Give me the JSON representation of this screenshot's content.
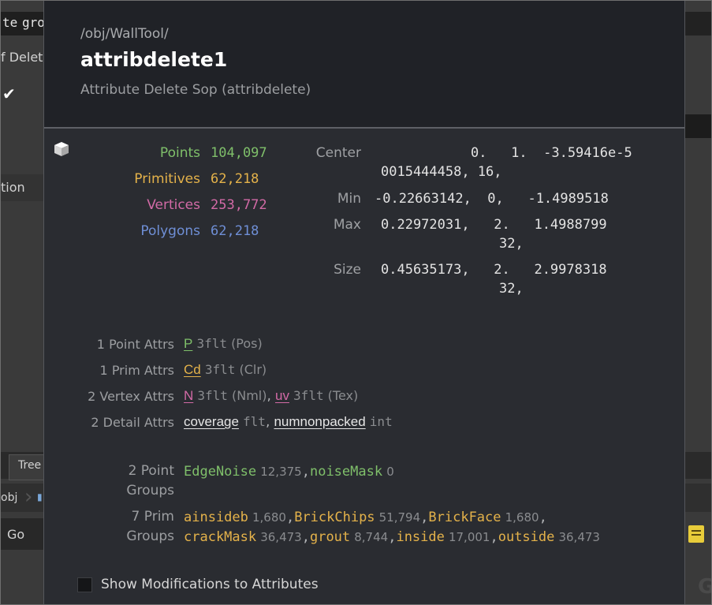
{
  "background": {
    "frag_top_left": "te",
    "frag_top_input": "gro",
    "frag_delete": "f Deleti",
    "frag_check": "✔",
    "frag_tion": "tion",
    "frag_tree": "Tree",
    "frag_obj": "obj",
    "frag_go": "Go",
    "frag_g": "G"
  },
  "node": {
    "path": "/obj/WallTool/",
    "name": "attribdelete1",
    "type": "Attribute Delete Sop (attribdelete)"
  },
  "stats": [
    {
      "label": "Points",
      "value": "104,097",
      "color": "#7fbf6a"
    },
    {
      "label": "Primitives",
      "value": "62,218",
      "color": "#e4b24a"
    },
    {
      "label": "Vertices",
      "value": "253,772",
      "color": "#d26aa6"
    },
    {
      "label": "Polygons",
      "value": "62,218",
      "color": "#6f8fd6"
    }
  ],
  "bbox": {
    "center_label": "Center",
    "center_l1": "0.   1.  -3.59416e-5",
    "center_l2": "0015444458, 16,",
    "min_label": "Min",
    "min_l1": "-0.22663142,  0,   -1.4989518",
    "max_label": "Max",
    "max_l1": "0.22972031,   2.   1.4988799",
    "max_l2": "32,",
    "size_label": "Size",
    "size_l1": "0.45635173,   2.   2.9978318",
    "size_l2": "32,"
  },
  "attributes": {
    "point_label": "1 Point Attrs",
    "point_name": "P",
    "point_type": "3flt",
    "point_extra": "(Pos)",
    "prim_label": "1 Prim Attrs",
    "prim_name": "Cd",
    "prim_type": "3flt",
    "prim_extra": "(Clr)",
    "vertex_label": "2 Vertex Attrs",
    "vertex_name1": "N",
    "vertex_type1": "3flt",
    "vertex_extra1": "(Nml)",
    "vertex_sep": ",",
    "vertex_name2": "uv",
    "vertex_type2": "3flt",
    "vertex_extra2": "(Tex)",
    "detail_label": "2 Detail Attrs",
    "detail_name1": "coverage",
    "detail_type1": "flt",
    "detail_sep": ",",
    "detail_name2": "numnonpacked",
    "detail_type2": "int"
  },
  "groups": {
    "point_label_1": "2 Point",
    "point_label_2": "Groups",
    "point_groups": [
      {
        "name": "EdgeNoise",
        "count": "12,375"
      },
      {
        "name": "noiseMask",
        "count": "0"
      }
    ],
    "prim_label_1": "7 Prim",
    "prim_label_2": "Groups",
    "prim_groups_line1": [
      {
        "name": "ainsideb",
        "count": "1,680"
      },
      {
        "name": "BrickChips",
        "count": "51,794"
      },
      {
        "name": "BrickFace",
        "count": "1,680"
      }
    ],
    "prim_groups_line2": [
      {
        "name": "crackMask",
        "count": "36,473"
      },
      {
        "name": "grout",
        "count": "8,744"
      },
      {
        "name": "inside",
        "count": "17,001"
      },
      {
        "name": "outside",
        "count": "36,473"
      }
    ],
    "sep": ","
  },
  "footer": {
    "show_mods_label": "Show Modifications to Attributes"
  },
  "colors": {
    "point": "#7fbf6a",
    "prim": "#e4b24a",
    "vertex": "#d26aa6",
    "detail": "#e6e6e6"
  }
}
